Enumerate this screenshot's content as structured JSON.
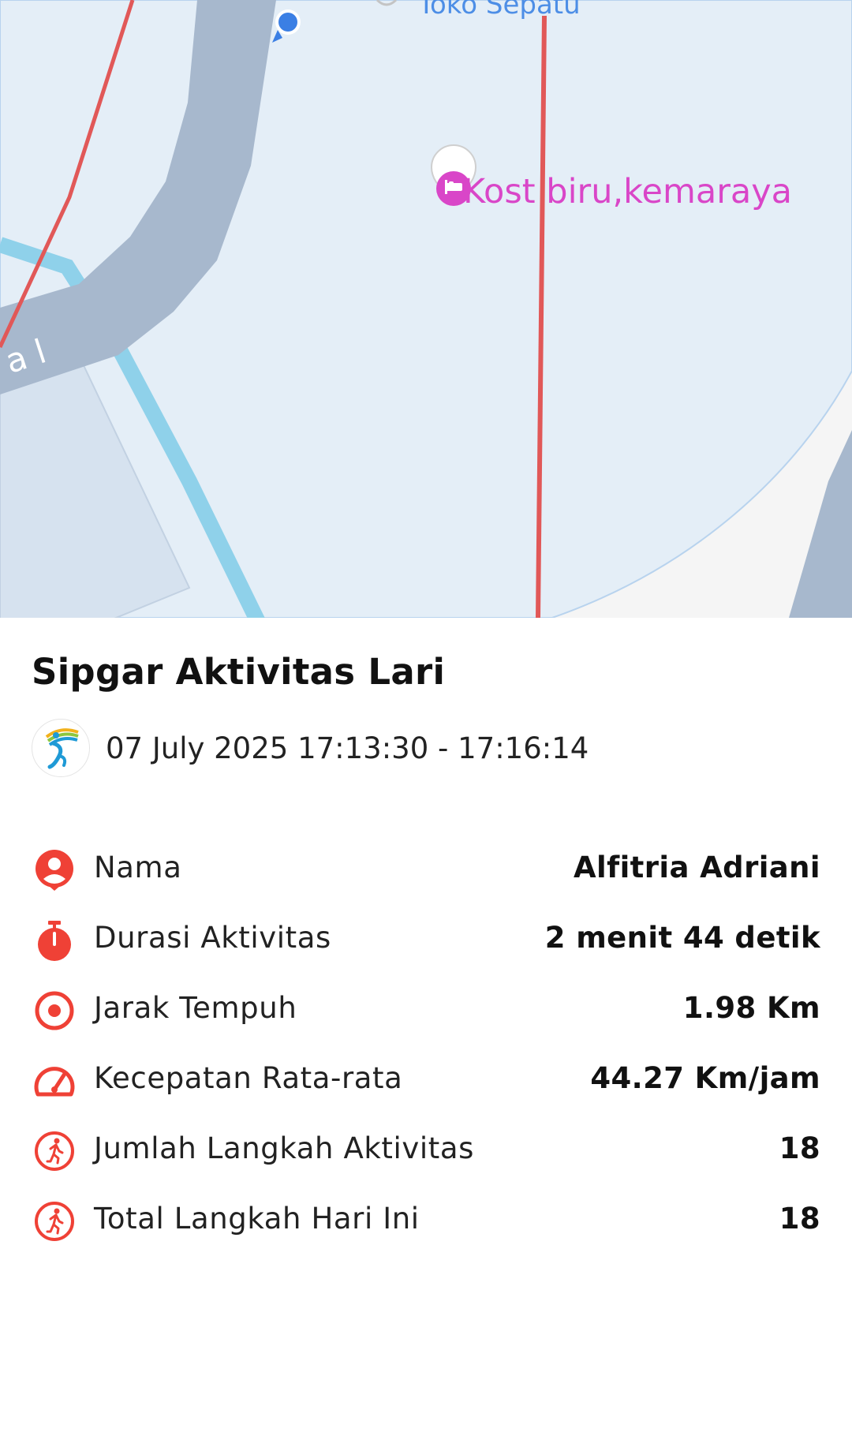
{
  "map": {
    "poi_label": "Kost biru,kemaraya",
    "top_label": "Toko Sepatu",
    "road_fragment": "a l"
  },
  "header": {
    "title": "Sipgar Aktivitas Lari",
    "time_range": "07 July 2025 17:13:30 - 17:16:14"
  },
  "stats": [
    {
      "icon": "person-pin-icon",
      "label": "Nama",
      "value": "Alfitria Adriani"
    },
    {
      "icon": "stopwatch-icon",
      "label": "Durasi Aktivitas",
      "value": "2 menit 44 detik"
    },
    {
      "icon": "target-icon",
      "label": "Jarak Tempuh",
      "value": "1.98 Km"
    },
    {
      "icon": "speedometer-icon",
      "label": "Kecepatan Rata-rata",
      "value": "44.27 Km/jam"
    },
    {
      "icon": "runner-icon",
      "label": "Jumlah Langkah Aktivitas",
      "value": "18"
    },
    {
      "icon": "runner-icon",
      "label": "Total Langkah Hari Ini",
      "value": "18"
    }
  ],
  "colors": {
    "accent": "#ef4136",
    "route": "#e15858",
    "poi": "#d946c8",
    "water": "#8fd1ea",
    "road": "#a7b8cd",
    "area": "#e4eef7"
  }
}
